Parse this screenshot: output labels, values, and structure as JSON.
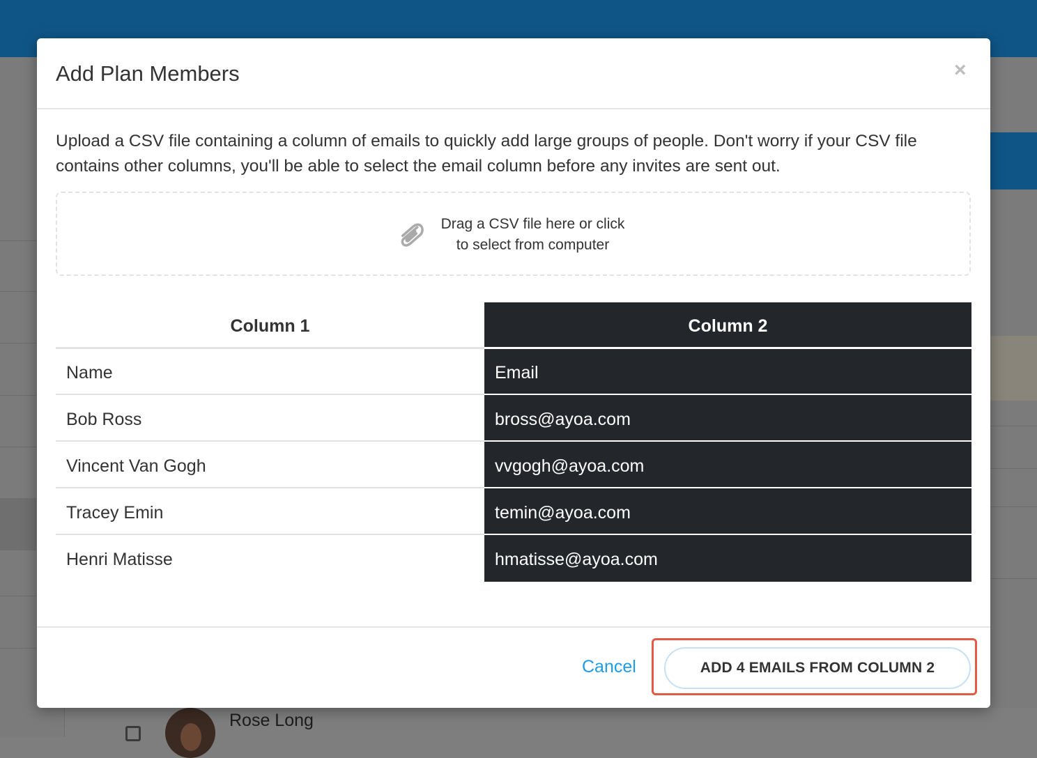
{
  "modal": {
    "title": "Add Plan Members",
    "close_glyph": "×",
    "intro": "Upload a CSV file containing a column of emails to quickly add large groups of people. Don't worry if your CSV file contains other columns, you'll be able to select the email column before any invites are sent out.",
    "dropzone": {
      "line1": "Drag a CSV file here or click",
      "line2": "to select from computer",
      "icon": "paperclip-icon"
    },
    "table": {
      "columns": [
        {
          "header": "Column 1",
          "cells": [
            "Name",
            "Bob Ross",
            "Vincent Van Gogh",
            "Tracey Emin",
            "Henri Matisse"
          ]
        },
        {
          "header": "Column 2",
          "cells": [
            "Email",
            "bross@ayoa.com",
            "vvgogh@ayoa.com",
            "temin@ayoa.com",
            "hmatisse@ayoa.com"
          ],
          "selected": true
        }
      ]
    },
    "footer": {
      "cancel_label": "Cancel",
      "add_label": "ADD 4 EMAILS FROM COLUMN 2"
    }
  },
  "background": {
    "visible_member_name": "Rose Long"
  },
  "colors": {
    "topbar": "#0f5687",
    "selected_column_bg": "#23272c",
    "cancel_link": "#1e9be9",
    "highlight_frame": "#e05a45"
  }
}
